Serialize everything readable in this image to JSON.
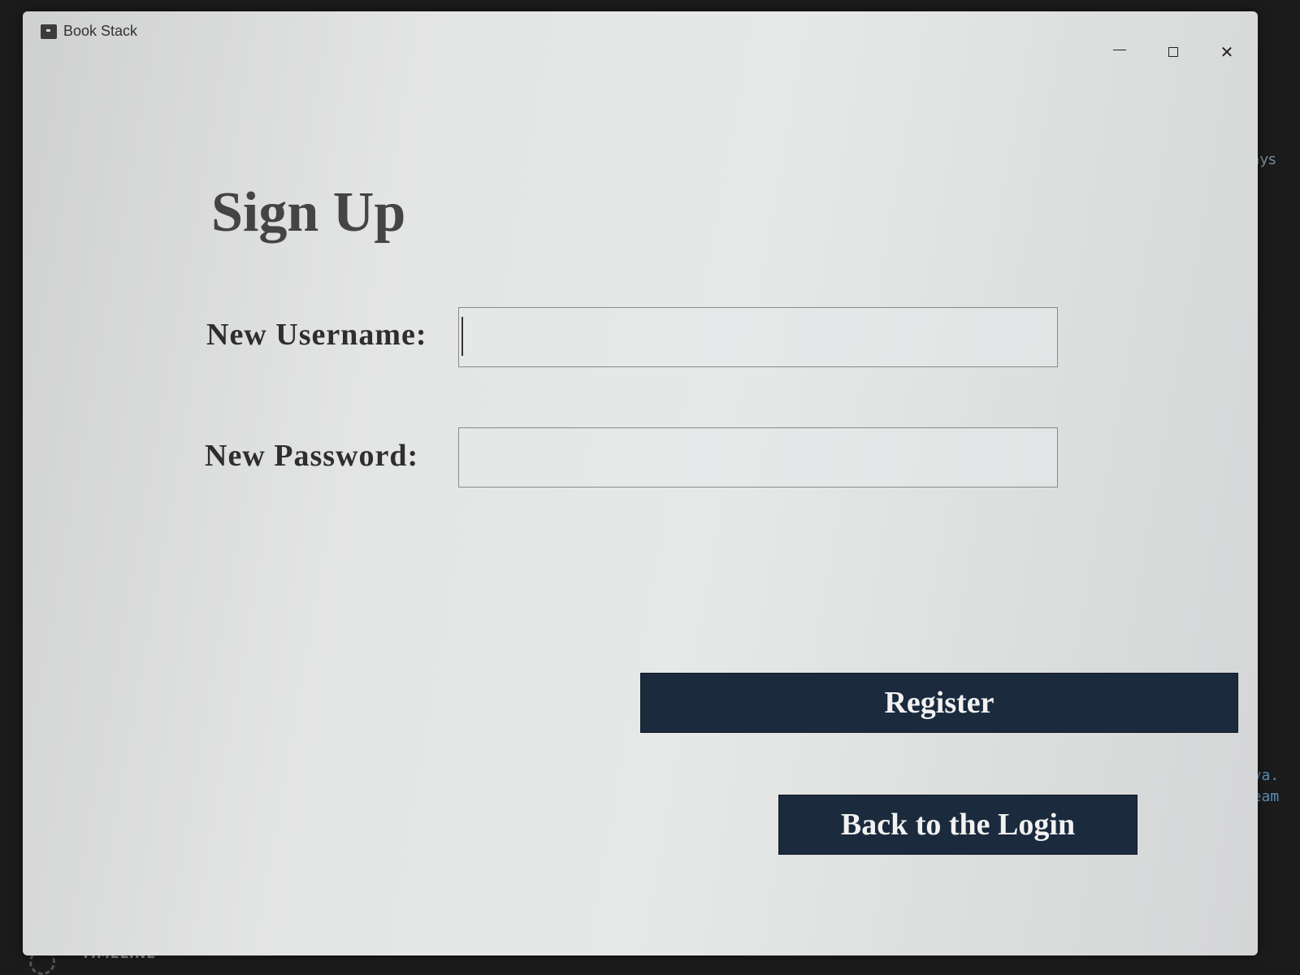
{
  "window": {
    "title": "Book Stack",
    "controls": {
      "minimize_icon": "minimize-icon",
      "maximize_icon": "maximize-icon",
      "close_icon": "close-icon",
      "close_glyph": "✕"
    }
  },
  "form": {
    "heading": "Sign Up",
    "username_label": "New Username:",
    "username_value": "",
    "password_label": "New Password:",
    "password_value": ""
  },
  "buttons": {
    "register_label": "Register",
    "back_label": "Back to the Login"
  },
  "background": {
    "days_text": "days",
    "code_line_1": "java.",
    "code_line_2": "-team",
    "timeline_label": "TIMELINE"
  },
  "colors": {
    "button_bg": "#1b2a3d",
    "button_text": "#f2f2f2",
    "heading_text": "#444444",
    "window_bg": "#e4e5e5"
  }
}
